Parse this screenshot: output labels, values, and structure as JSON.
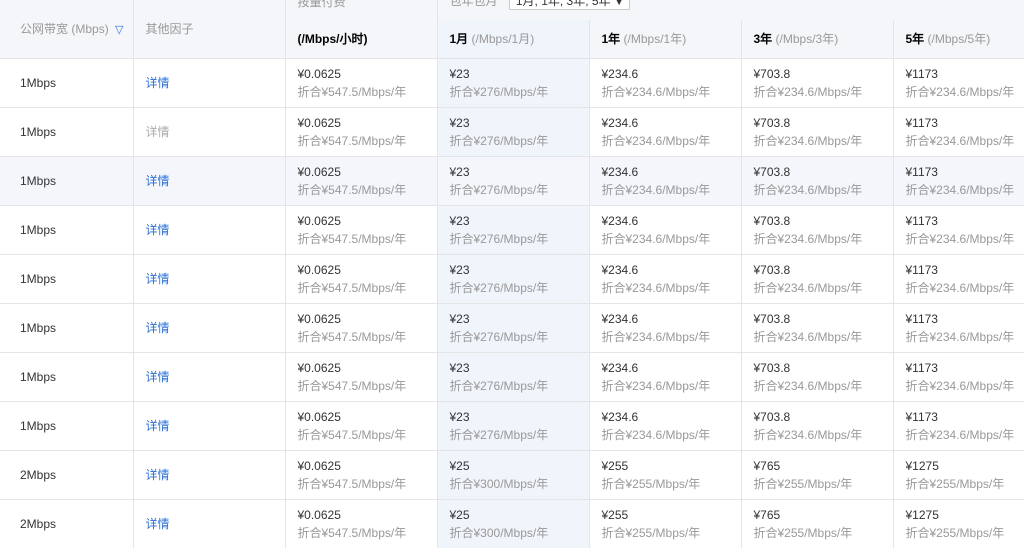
{
  "header": {
    "bandwidth_label": "公网带宽",
    "bandwidth_unit": "(Mbps)",
    "other_factor": "其他因子",
    "usage_label": "按量付费",
    "package_label": "包年包月",
    "package_select": "1月, 1年, 3年, 5年",
    "col_hourly": "(/Mbps/小时)",
    "col_1m": "1月",
    "col_1m_unit": "(/Mbps/1月)",
    "col_1y": "1年",
    "col_1y_unit": "(/Mbps/1年)",
    "col_3y": "3年",
    "col_3y_unit": "(/Mbps/3年)",
    "col_5y": "5年",
    "col_5y_unit": "(/Mbps/5年)"
  },
  "rows": [
    {
      "bw": "1Mbps",
      "detail": "详情",
      "h": "¥0.0625",
      "hs": "折合¥547.5/Mbps/年",
      "m": "¥23",
      "ms": "折合¥276/Mbps/年",
      "y1": "¥234.6",
      "y1s": "折合¥234.6/Mbps/年",
      "y3": "¥703.8",
      "y3s": "折合¥234.6/Mbps/年",
      "y5": "¥1173",
      "y5s": "折合¥234.6/Mbps/年"
    },
    {
      "bw": "1Mbps",
      "detail": "详情",
      "h": "¥0.0625",
      "hs": "折合¥547.5/Mbps/年",
      "m": "¥23",
      "ms": "折合¥276/Mbps/年",
      "y1": "¥234.6",
      "y1s": "折合¥234.6/Mbps/年",
      "y3": "¥703.8",
      "y3s": "折合¥234.6/Mbps/年",
      "y5": "¥1173",
      "y5s": "折合¥234.6/Mbps/年"
    },
    {
      "bw": "1Mbps",
      "detail": "详情",
      "h": "¥0.0625",
      "hs": "折合¥547.5/Mbps/年",
      "m": "¥23",
      "ms": "折合¥276/Mbps/年",
      "y1": "¥234.6",
      "y1s": "折合¥234.6/Mbps/年",
      "y3": "¥703.8",
      "y3s": "折合¥234.6/Mbps/年",
      "y5": "¥1173",
      "y5s": "折合¥234.6/Mbps/年"
    },
    {
      "bw": "1Mbps",
      "detail": "详情",
      "h": "¥0.0625",
      "hs": "折合¥547.5/Mbps/年",
      "m": "¥23",
      "ms": "折合¥276/Mbps/年",
      "y1": "¥234.6",
      "y1s": "折合¥234.6/Mbps/年",
      "y3": "¥703.8",
      "y3s": "折合¥234.6/Mbps/年",
      "y5": "¥1173",
      "y5s": "折合¥234.6/Mbps/年"
    },
    {
      "bw": "1Mbps",
      "detail": "详情",
      "h": "¥0.0625",
      "hs": "折合¥547.5/Mbps/年",
      "m": "¥23",
      "ms": "折合¥276/Mbps/年",
      "y1": "¥234.6",
      "y1s": "折合¥234.6/Mbps/年",
      "y3": "¥703.8",
      "y3s": "折合¥234.6/Mbps/年",
      "y5": "¥1173",
      "y5s": "折合¥234.6/Mbps/年"
    },
    {
      "bw": "1Mbps",
      "detail": "详情",
      "h": "¥0.0625",
      "hs": "折合¥547.5/Mbps/年",
      "m": "¥23",
      "ms": "折合¥276/Mbps/年",
      "y1": "¥234.6",
      "y1s": "折合¥234.6/Mbps/年",
      "y3": "¥703.8",
      "y3s": "折合¥234.6/Mbps/年",
      "y5": "¥1173",
      "y5s": "折合¥234.6/Mbps/年"
    },
    {
      "bw": "1Mbps",
      "detail": "详情",
      "h": "¥0.0625",
      "hs": "折合¥547.5/Mbps/年",
      "m": "¥23",
      "ms": "折合¥276/Mbps/年",
      "y1": "¥234.6",
      "y1s": "折合¥234.6/Mbps/年",
      "y3": "¥703.8",
      "y3s": "折合¥234.6/Mbps/年",
      "y5": "¥1173",
      "y5s": "折合¥234.6/Mbps/年"
    },
    {
      "bw": "1Mbps",
      "detail": "详情",
      "h": "¥0.0625",
      "hs": "折合¥547.5/Mbps/年",
      "m": "¥23",
      "ms": "折合¥276/Mbps/年",
      "y1": "¥234.6",
      "y1s": "折合¥234.6/Mbps/年",
      "y3": "¥703.8",
      "y3s": "折合¥234.6/Mbps/年",
      "y5": "¥1173",
      "y5s": "折合¥234.6/Mbps/年"
    },
    {
      "bw": "2Mbps",
      "detail": "详情",
      "h": "¥0.0625",
      "hs": "折合¥547.5/Mbps/年",
      "m": "¥25",
      "ms": "折合¥300/Mbps/年",
      "y1": "¥255",
      "y1s": "折合¥255/Mbps/年",
      "y3": "¥765",
      "y3s": "折合¥255/Mbps/年",
      "y5": "¥1275",
      "y5s": "折合¥255/Mbps/年"
    },
    {
      "bw": "2Mbps",
      "detail": "详情",
      "h": "¥0.0625",
      "hs": "折合¥547.5/Mbps/年",
      "m": "¥25",
      "ms": "折合¥300/Mbps/年",
      "y1": "¥255",
      "y1s": "折合¥255/Mbps/年",
      "y3": "¥765",
      "y3s": "折合¥255/Mbps/年",
      "y5": "¥1275",
      "y5s": "折合¥255/Mbps/年"
    }
  ],
  "disabled_detail_row": 1,
  "hover_row": 2
}
